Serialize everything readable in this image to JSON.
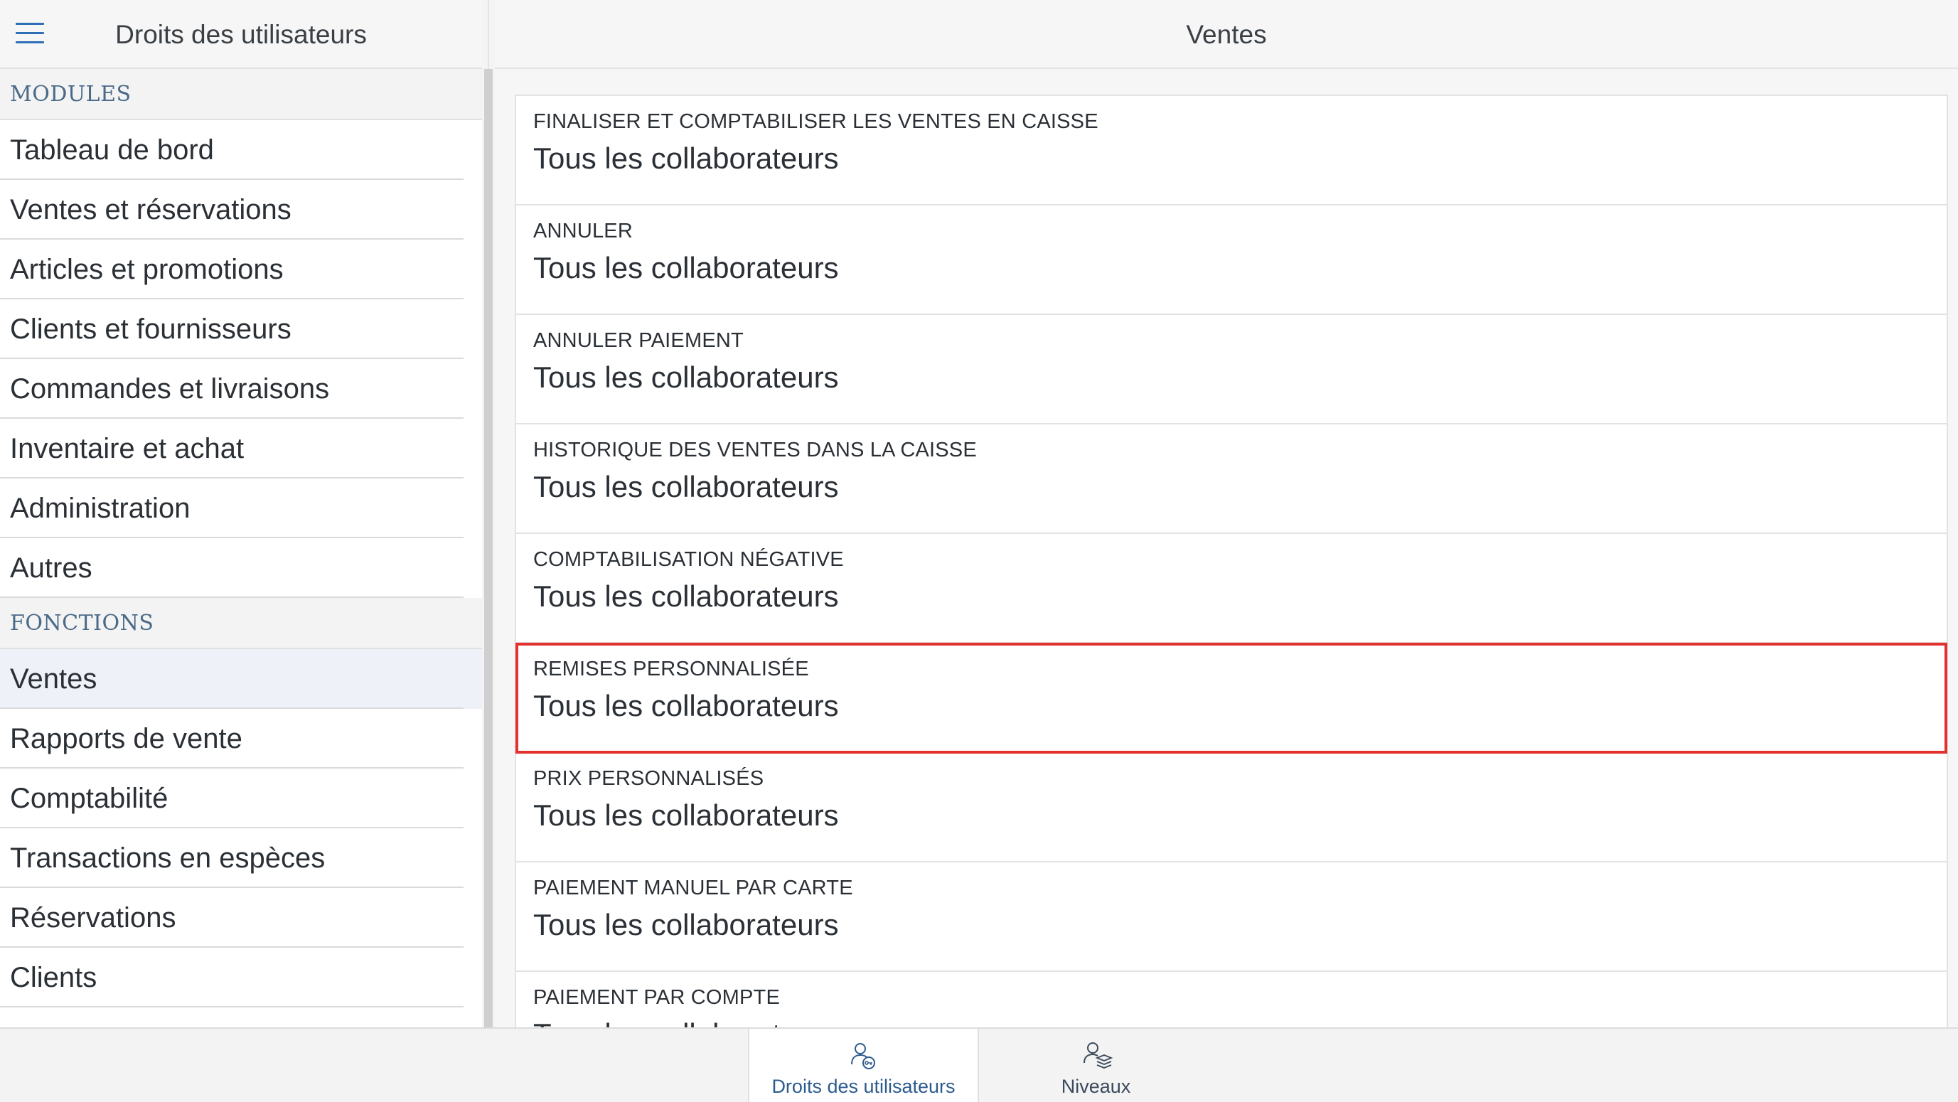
{
  "left_panel": {
    "title": "Droits des utilisateurs",
    "sections": [
      {
        "header": "MODULES",
        "items": [
          "Tableau de bord",
          "Ventes et réservations",
          "Articles et promotions",
          "Clients et fournisseurs",
          "Commandes et livraisons",
          "Inventaire et achat",
          "Administration",
          "Autres"
        ]
      },
      {
        "header": "FONCTIONS",
        "items": [
          "Ventes",
          "Rapports de vente",
          "Comptabilité",
          "Transactions en espèces",
          "Réservations",
          "Clients"
        ],
        "active_item": "Ventes"
      }
    ]
  },
  "right_panel": {
    "title": "Ventes",
    "permissions": [
      {
        "label": "FINALISER ET COMPTABILISER LES VENTES EN CAISSE",
        "value": "Tous les collaborateurs"
      },
      {
        "label": "ANNULER",
        "value": "Tous les collaborateurs"
      },
      {
        "label": "ANNULER PAIEMENT",
        "value": "Tous les collaborateurs"
      },
      {
        "label": "HISTORIQUE DES VENTES DANS LA CAISSE",
        "value": "Tous les collaborateurs"
      },
      {
        "label": "COMPTABILISATION NÉGATIVE",
        "value": "Tous les collaborateurs"
      },
      {
        "label": "REMISES PERSONNALISÉE",
        "value": "Tous les collaborateurs"
      },
      {
        "label": "PRIX PERSONNALISÉS",
        "value": "Tous les collaborateurs"
      },
      {
        "label": "PAIEMENT MANUEL PAR CARTE",
        "value": "Tous les collaborateurs"
      },
      {
        "label": "PAIEMENT PAR COMPTE",
        "value": "Tous les collaborateurs"
      }
    ]
  },
  "bottom_tabs": [
    {
      "label": "Droits des utilisateurs",
      "icon": "user-rights-icon",
      "active": true
    },
    {
      "label": "Niveaux",
      "icon": "levels-icon",
      "active": false
    }
  ],
  "colors": {
    "accent": "#2c6fb7",
    "highlight": "#e2312f",
    "section_header_text": "#4a6a88"
  }
}
